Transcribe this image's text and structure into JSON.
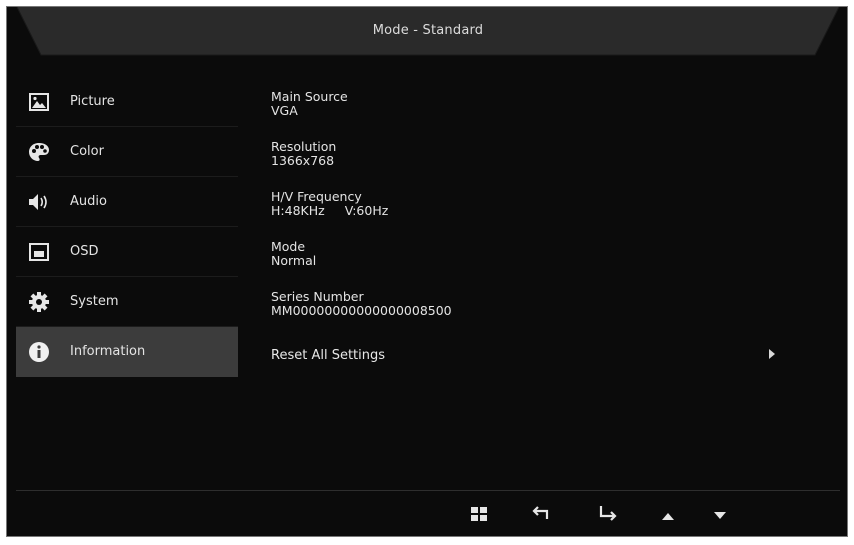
{
  "header": {
    "title": "Mode - Standard"
  },
  "sidebar": {
    "items": [
      {
        "label": "Picture",
        "icon": "picture-icon",
        "active": false
      },
      {
        "label": "Color",
        "icon": "palette-icon",
        "active": false
      },
      {
        "label": "Audio",
        "icon": "speaker-icon",
        "active": false
      },
      {
        "label": "OSD",
        "icon": "osd-window-icon",
        "active": false
      },
      {
        "label": "System",
        "icon": "gear-icon",
        "active": false
      },
      {
        "label": "Information",
        "icon": "info-icon",
        "active": true
      }
    ]
  },
  "info": {
    "main_source": {
      "label": "Main Source",
      "value": "VGA"
    },
    "resolution": {
      "label": "Resolution",
      "value": "1366x768"
    },
    "frequency": {
      "label": "H/V Frequency",
      "h_value": "H:48KHz",
      "v_value": "V:60Hz"
    },
    "mode": {
      "label": "Mode",
      "value": "Normal"
    },
    "series_number": {
      "label": "Series Number",
      "value": "MM00000000000000008500"
    },
    "reset": {
      "label": "Reset All Settings"
    }
  },
  "footer": {
    "buttons": [
      "menu-grid-icon",
      "back-icon",
      "enter-icon",
      "up-arrow-icon",
      "down-arrow-icon"
    ]
  },
  "colors": {
    "background": "#0b0b0b",
    "active_item": "#3c3c3c",
    "text": "#e4e4e4"
  }
}
